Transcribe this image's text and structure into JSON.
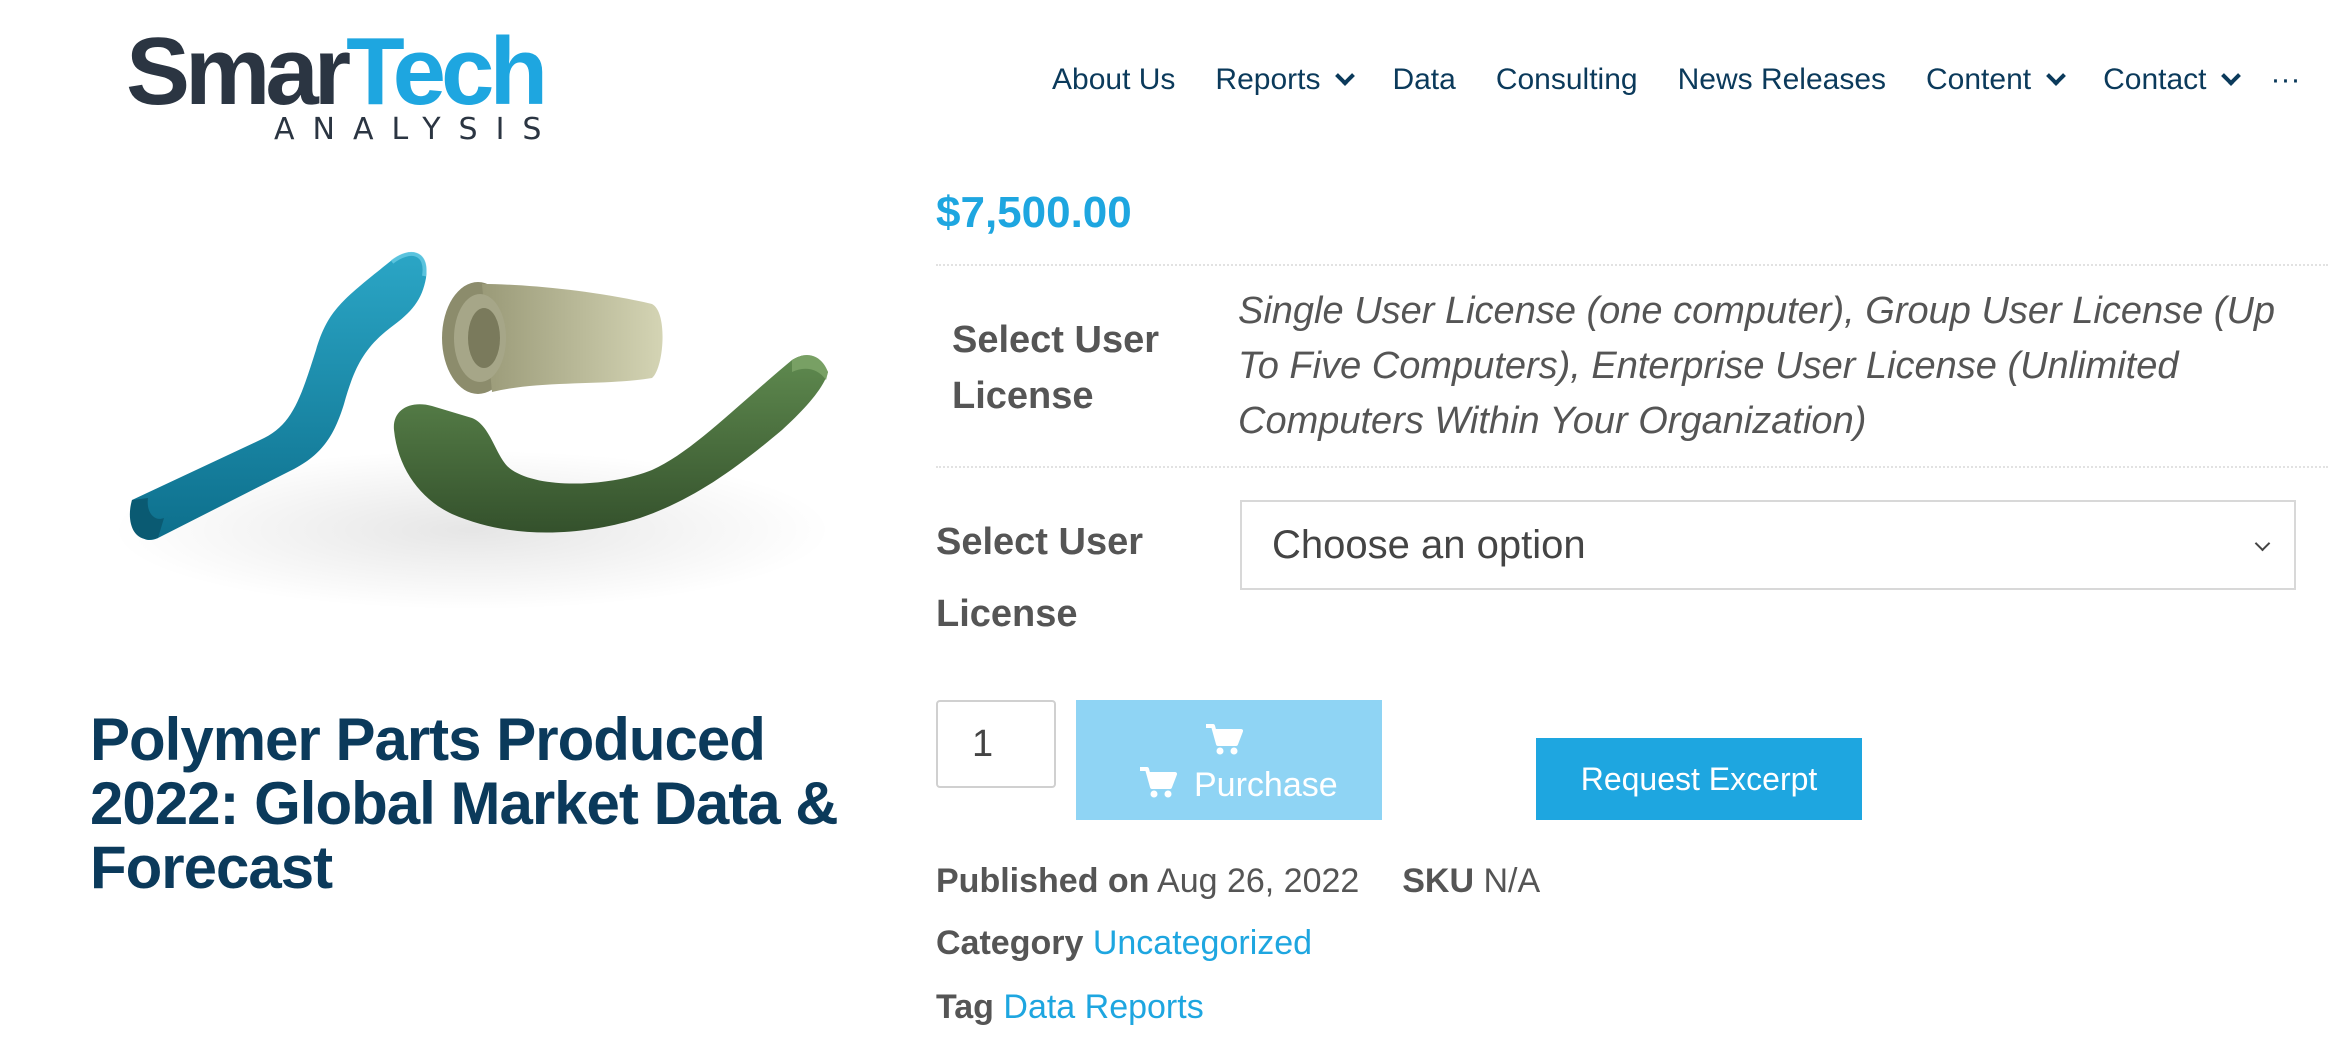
{
  "brand": {
    "word1": "Smar",
    "word2": "Tech",
    "sub": "ANALYSIS"
  },
  "nav": {
    "items": [
      {
        "label": "About Us",
        "dropdown": false
      },
      {
        "label": "Reports",
        "dropdown": true
      },
      {
        "label": "Data",
        "dropdown": false
      },
      {
        "label": "Consulting",
        "dropdown": false
      },
      {
        "label": "News Releases",
        "dropdown": false
      },
      {
        "label": "Content",
        "dropdown": true
      },
      {
        "label": "Contact",
        "dropdown": true
      }
    ],
    "more": "···"
  },
  "product": {
    "title": "Polymer Parts Produced 2022: Global Market Data & Forecast",
    "price": "$7,500.00",
    "attribute": {
      "label": "Select User License",
      "value": "Single User License (one computer), Group User License (Up To Five Computers), Enterprise User License (Unlimited Computers Within Your Organization)"
    },
    "variation": {
      "label": "Select User License",
      "selected": "Choose an option"
    },
    "quantity": "1",
    "purchase_label": "Purchase",
    "excerpt_label": "Request Excerpt",
    "meta": {
      "published_label": "Published on",
      "published_value": "Aug 26, 2022",
      "sku_label": "SKU",
      "sku_value": "N/A",
      "category_label": "Category",
      "category_value": "Uncategorized",
      "tag_label": "Tag",
      "tag_value": "Data Reports"
    }
  },
  "colors": {
    "accent": "#1ea6e0",
    "navy": "#0b3a5b",
    "purchase_bg": "#8fd4f4"
  }
}
